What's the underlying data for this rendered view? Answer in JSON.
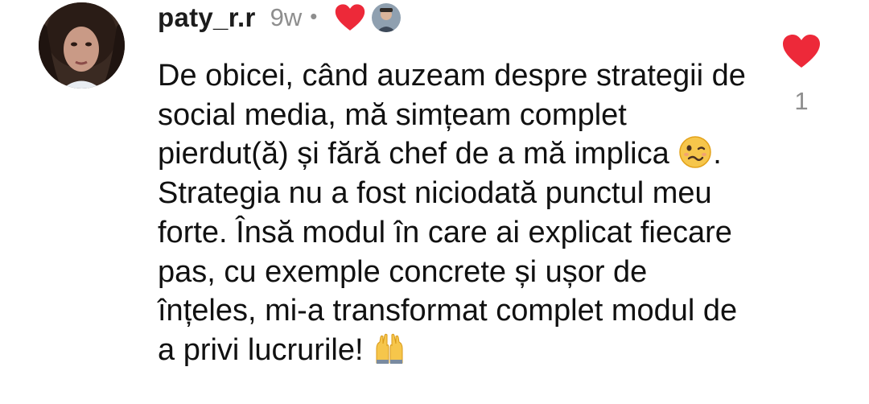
{
  "comment": {
    "username": "paty_r.r",
    "timestamp": "9w",
    "separator": "•",
    "text_parts": [
      "De obicei, când auzeam despre strategii de social media, mă simțeam complet pierdut(ă) și fără chef de a mă implica ",
      ". Strategia nu a fost niciodată punctul meu forte. Însă modul în care ai explicat fiecare pas, cu exemple concrete și ușor de înțeles, mi-a transformat complet modul de a privi lucrurile! "
    ],
    "emojis": [
      "woozy-face",
      "raising-hands"
    ],
    "creator_liked": true
  },
  "likes": {
    "count": "1"
  },
  "colors": {
    "heart": "#ed2939",
    "muted": "#8e8e8e",
    "text": "#111111"
  }
}
